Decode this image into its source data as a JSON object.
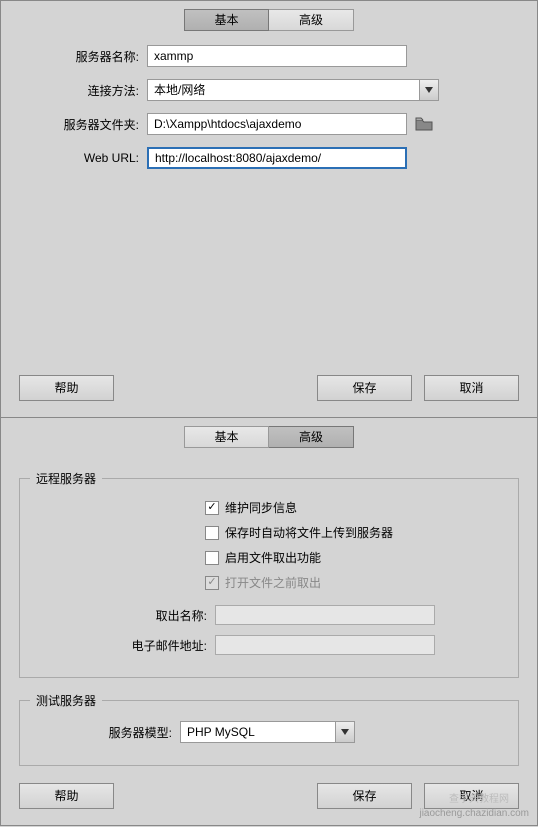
{
  "top": {
    "tabs": {
      "basic": "基本",
      "advanced": "高级",
      "active": "basic"
    },
    "labels": {
      "server_name": "服务器名称:",
      "connect_method": "连接方法:",
      "server_folder": "服务器文件夹:",
      "web_url": "Web URL:"
    },
    "values": {
      "server_name": "xammp",
      "connect_method": "本地/网络",
      "server_folder": "D:\\Xampp\\htdocs\\ajaxdemo",
      "web_url": "http://localhost:8080/ajaxdemo/"
    },
    "buttons": {
      "help": "帮助",
      "save": "保存",
      "cancel": "取消"
    }
  },
  "bottom": {
    "tabs": {
      "basic": "基本",
      "advanced": "高级",
      "active": "advanced"
    },
    "remote": {
      "legend": "远程服务器",
      "chk1": "维护同步信息",
      "chk2": "保存时自动将文件上传到服务器",
      "chk3": "启用文件取出功能",
      "chk4": "打开文件之前取出",
      "checkout_name": "取出名称:",
      "email": "电子邮件地址:"
    },
    "test": {
      "legend": "测试服务器",
      "model_label": "服务器模型:",
      "model_value": "PHP MySQL"
    },
    "buttons": {
      "help": "帮助",
      "save": "保存",
      "cancel": "取消"
    }
  },
  "watermark": "jiaocheng.chazidian.com",
  "watermark2": "查字典教程网"
}
